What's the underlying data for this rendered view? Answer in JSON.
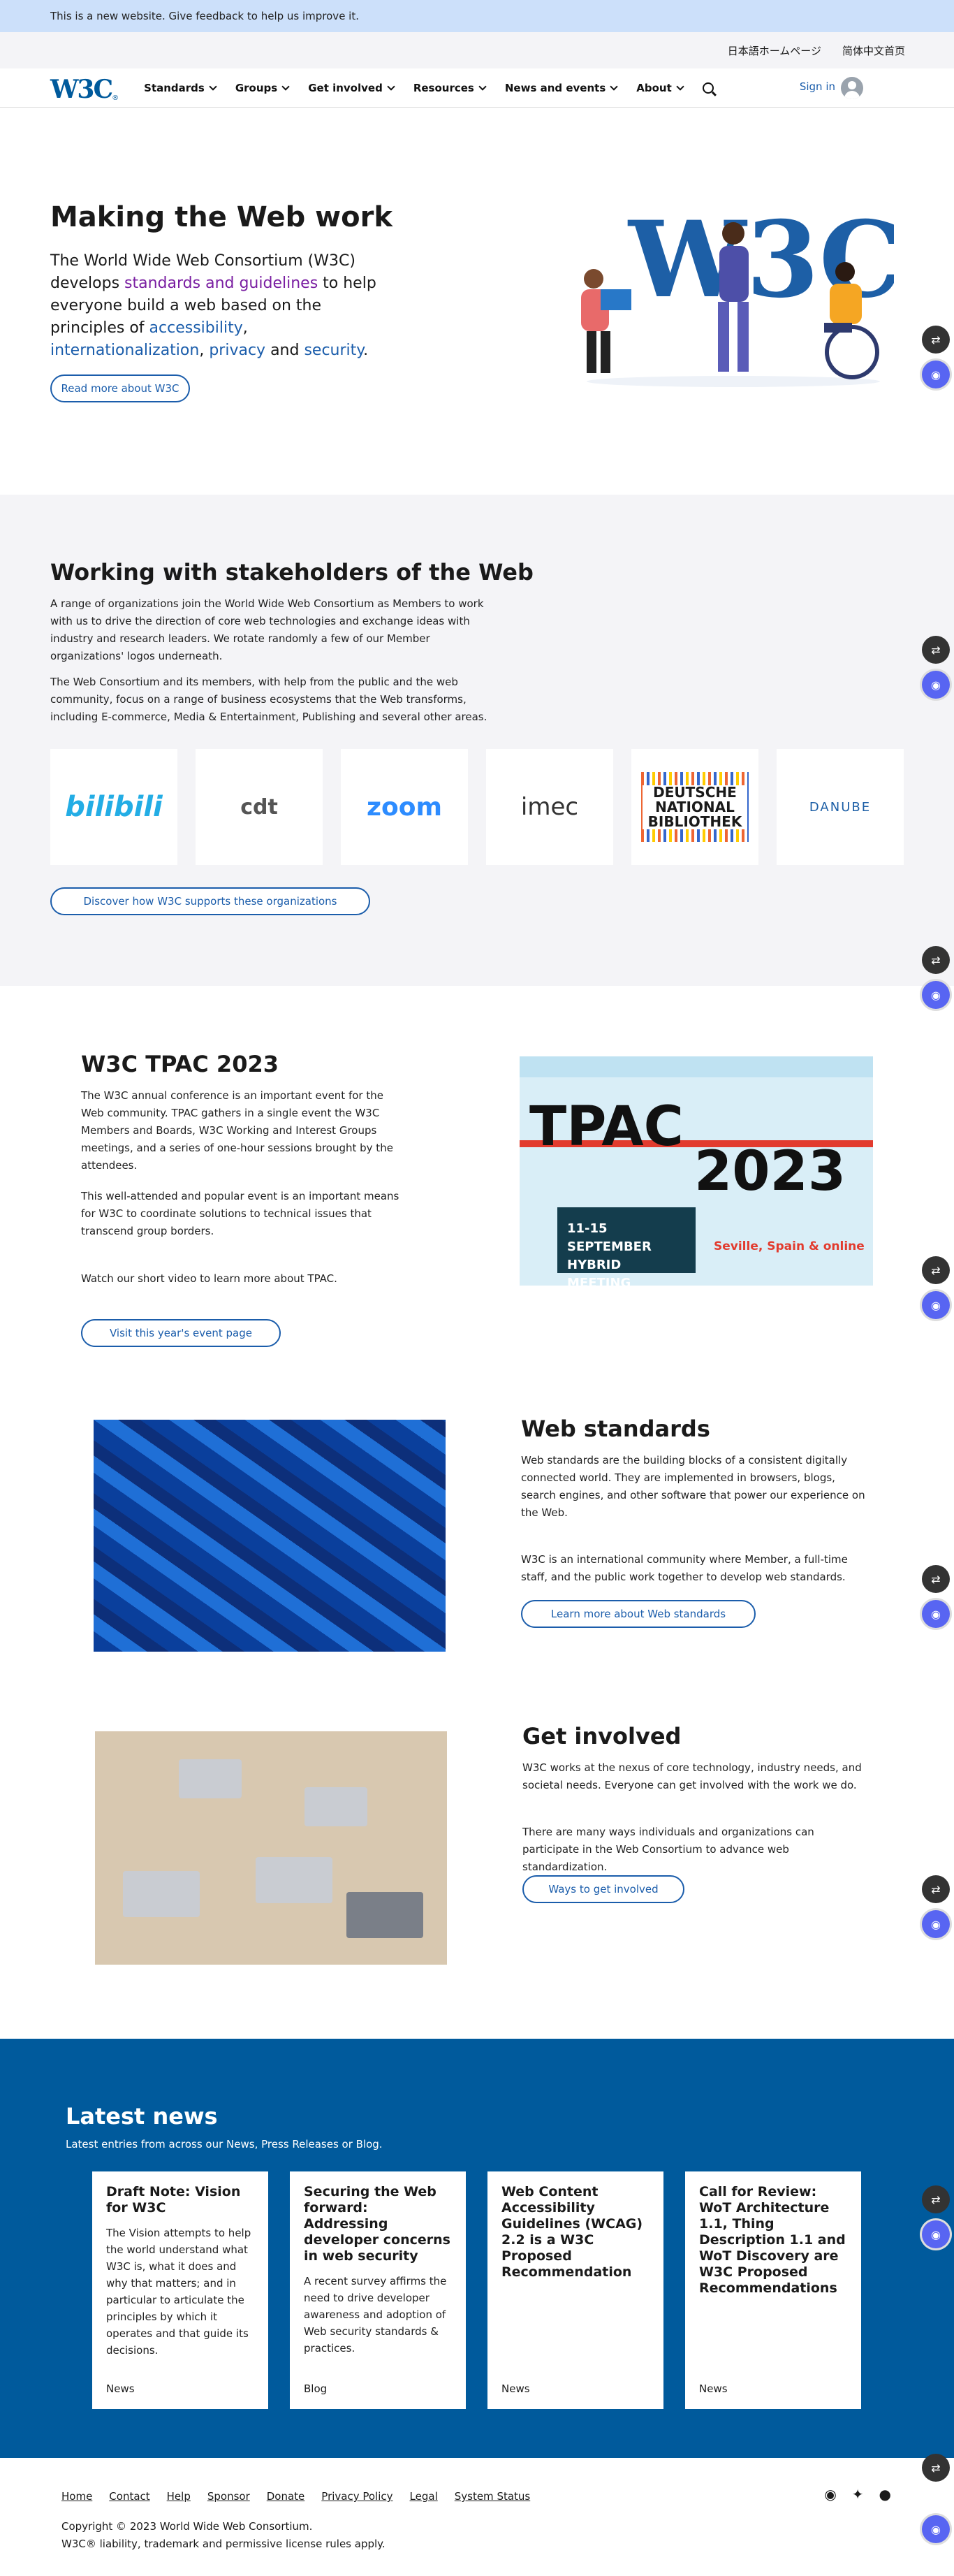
{
  "banner": {
    "text": "This is a new website. Give feedback to help us improve it."
  },
  "langbar": {
    "ja": "日本語ホームページ",
    "zh": "简体中文首页"
  },
  "nav": {
    "logo": "W3C",
    "items": [
      "Standards",
      "Groups",
      "Get involved",
      "Resources",
      "News and events",
      "About"
    ],
    "signin": "Sign in"
  },
  "hero": {
    "title": "Making the Web work",
    "intro1": "The World Wide Web Consortium (W3C) develops ",
    "link1": "standards and guidelines",
    "intro2": " to help everyone build a web based on the principles of ",
    "link2": "accessibility",
    "sep1": ", ",
    "link3": "internationalization",
    "sep2": ", ",
    "link4": "privacy",
    "sep3": " and ",
    "link5": "security",
    "end": ".",
    "button": "Read more about W3C",
    "art_text": "W3C"
  },
  "stakeholders": {
    "title": "Working with stakeholders of the Web",
    "p1": "A range of organizations join the World Wide Web Consortium as Members to work with us to drive the direction of core web technologies and exchange ideas with industry and research leaders. We rotate randomly a few of our Member organizations' logos underneath.",
    "p2": "The Web Consortium and its members, with help from the public and the web community, focus on a range of business ecosystems that the Web transforms, including E-commerce, Media & Entertainment, Publishing and several other areas.",
    "logos": [
      "bilibili",
      "cdt",
      "zoom",
      "imec",
      "DEUTSCHE NATIONAL BIBLIOTHEK",
      "DANUBE"
    ],
    "button": "Discover how W3C supports these organizations"
  },
  "tpac": {
    "title": "W3C TPAC 2023",
    "p1": "The W3C annual conference is an important event for the Web community. TPAC gathers in a single event the W3C Members and Boards, W3C Working and Interest Groups meetings, and a series of one-hour sessions brought by the attendees.",
    "p2": "This well-attended and popular event is an important means for W3C to coordinate solutions to technical issues that transcend group borders.",
    "p3": "Watch our short video to learn more about TPAC.",
    "button": "Visit this year's event page",
    "img": {
      "word": "TPAC",
      "year": "2023",
      "dates": "11-15 SEPTEMBER",
      "mode": "HYBRID MEETING",
      "place": "Seville, Spain & online"
    }
  },
  "standards": {
    "title": "Web standards",
    "p1": "Web standards are the building blocks of a consistent digitally connected world. They are implemented in browsers, blogs, search engines, and other software that power our experience on the Web.",
    "p2": "W3C is an international community where Member, a full-time staff, and the public work together to develop web standards.",
    "button": "Learn more about Web standards"
  },
  "involved": {
    "title": "Get involved",
    "p1": "W3C works at the nexus of core technology, industry needs, and societal needs. Everyone can get involved with the work we do.",
    "p2": "There are many ways individuals and organizations can participate in the Web Consortium to advance web standardization.",
    "button": "Ways to get involved"
  },
  "news": {
    "title": "Latest news",
    "subtitle": "Latest entries from across our News, Press Releases or Blog.",
    "items": [
      {
        "title": "Draft Note: Vision for W3C",
        "text": "The Vision attempts to help the world understand what W3C is, what it does and why that matters; and in particular to articulate the principles by which it operates and that guide its decisions.",
        "tag": "News"
      },
      {
        "title": "Securing the Web forward: Addressing developer concerns in web security",
        "text": "A recent survey affirms the need to drive developer awareness and adoption of Web security standards & practices.",
        "tag": "Blog"
      },
      {
        "title": "Web Content Accessibility Guidelines (WCAG) 2.2 is a W3C Proposed Recommendation",
        "text": "",
        "tag": "News"
      },
      {
        "title": "Call for Review: WoT Architecture 1.1, Thing Description 1.1 and WoT Discovery are W3C Proposed Recommendations",
        "text": "",
        "tag": "News"
      }
    ]
  },
  "footer": {
    "links": [
      "Home",
      "Contact",
      "Help",
      "Sponsor",
      "Donate",
      "Privacy Policy",
      "Legal",
      "System Status"
    ],
    "copy1": "Copyright © 2023 World Wide Web Consortium.",
    "copy2": "W3C® liability, trademark and permissive license rules apply."
  },
  "colors": {
    "brand": "#005a9c",
    "link": "#1b5dab",
    "banner": "#cce0fa",
    "grey": "#f4f4f7"
  }
}
